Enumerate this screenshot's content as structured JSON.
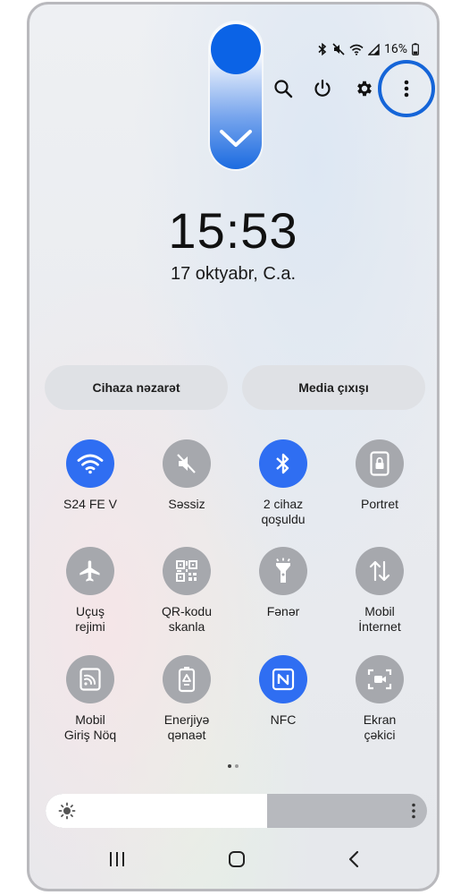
{
  "status_bar": {
    "battery": "16%",
    "icons": [
      "bluetooth-icon",
      "mute-icon",
      "wifi-icon",
      "signal-icon",
      "battery-icon"
    ]
  },
  "top_icons": [
    "search-icon",
    "power-icon",
    "settings-gear-icon",
    "more-options-icon"
  ],
  "clock": {
    "time": "15:53",
    "date": "17 oktyabr, C.a."
  },
  "buttons": {
    "device_control": "Cihaza nəzarət",
    "media_output": "Media çıxışı"
  },
  "tiles": [
    {
      "label": "S24 FE V",
      "icon": "wifi-icon",
      "on": true
    },
    {
      "label": "Səssiz",
      "icon": "mute-icon",
      "on": false
    },
    {
      "label": "2 cihaz qoşuldu",
      "icon": "bluetooth-icon",
      "on": true
    },
    {
      "label": "Portret",
      "icon": "portrait-lock-icon",
      "on": false
    },
    {
      "label": "Uçuş rejimi",
      "icon": "airplane-icon",
      "on": false
    },
    {
      "label": "QR-kodu skanla",
      "icon": "qr-code-icon",
      "on": false
    },
    {
      "label": "Fənər",
      "icon": "flashlight-icon",
      "on": false
    },
    {
      "label": "Mobil İnternet",
      "icon": "mobile-data-icon",
      "on": false
    },
    {
      "label": "Mobil Giriş Nöq",
      "icon": "hotspot-icon",
      "on": false
    },
    {
      "label": "Enerjiyə qənaət",
      "icon": "power-saving-icon",
      "on": false
    },
    {
      "label": "NFC",
      "icon": "nfc-icon",
      "on": true
    },
    {
      "label": "Ekran çəkici",
      "icon": "screen-recorder-icon",
      "on": false
    }
  ],
  "brightness": {
    "level": 0.58
  },
  "colors": {
    "accent": "#2f6ef2",
    "highlight": "#1565d8",
    "tile_off": "#a6a8ad"
  }
}
